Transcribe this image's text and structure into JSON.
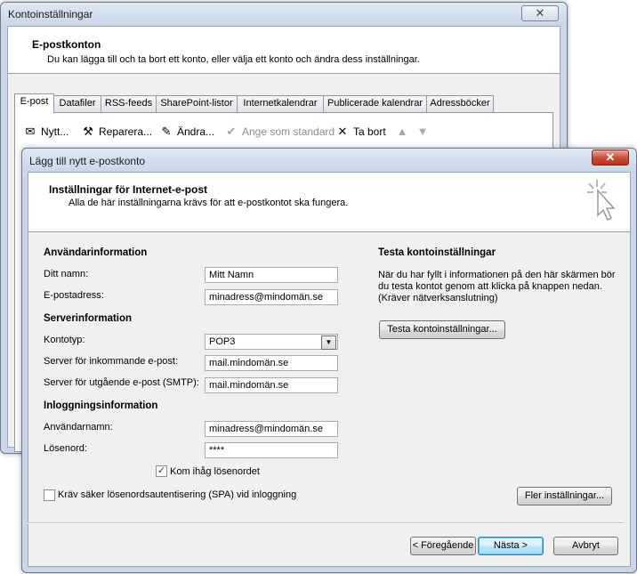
{
  "back_window": {
    "title": "Kontoinställningar",
    "close_glyph": "✕",
    "header_title": "E-postkonton",
    "header_sub": "Du kan lägga till och ta bort ett konto, eller välja ett konto och ändra dess inställningar.",
    "tabs": [
      "E-post",
      "Datafiler",
      "RSS-feeds",
      "SharePoint-listor",
      "Internetkalendrar",
      "Publicerade kalendrar",
      "Adressböcker"
    ],
    "toolbar": {
      "new": "Nytt...",
      "repair": "Reparera...",
      "change": "Ändra...",
      "set_default": "Ange som standard",
      "remove": "Ta bort"
    }
  },
  "dialog": {
    "title": "Lägg till nytt e-postkonto",
    "close_glyph": "✕",
    "header_title": "Inställningar för Internet-e-post",
    "header_sub": "Alla de här inställningarna krävs för att e-postkontot ska fungera.",
    "user_info": {
      "section": "Användarinformation",
      "name_label": "Ditt namn:",
      "name_value": "Mitt Namn",
      "email_label": "E-postadress:",
      "email_value": "minadress@mindomän.se"
    },
    "server_info": {
      "section": "Serverinformation",
      "type_label": "Kontotyp:",
      "type_value": "POP3",
      "incoming_label": "Server för inkommande e-post:",
      "incoming_value": "mail.mindomän.se",
      "outgoing_label": "Server för utgående e-post (SMTP):",
      "outgoing_value": "mail.mindomän.se"
    },
    "login_info": {
      "section": "Inloggningsinformation",
      "username_label": "Användarnamn:",
      "username_value": "minadress@mindomän.se",
      "password_label": "Lösenord:",
      "password_value": "****",
      "remember_label": "Kom ihåg lösenordet",
      "remember_checked": true
    },
    "spa_label": "Kräv säker lösenordsautentisering (SPA) vid inloggning",
    "spa_checked": false,
    "test": {
      "section": "Testa kontoinställningar",
      "description": "När du har fyllt i informationen på den här skärmen bör du testa kontot genom att klicka på knappen nedan. (Kräver nätverksanslutning)",
      "button": "Testa kontoinställningar..."
    },
    "more_settings": "Fler inställningar...",
    "back": "< Föregående",
    "next": "Nästa >",
    "cancel": "Avbryt"
  }
}
